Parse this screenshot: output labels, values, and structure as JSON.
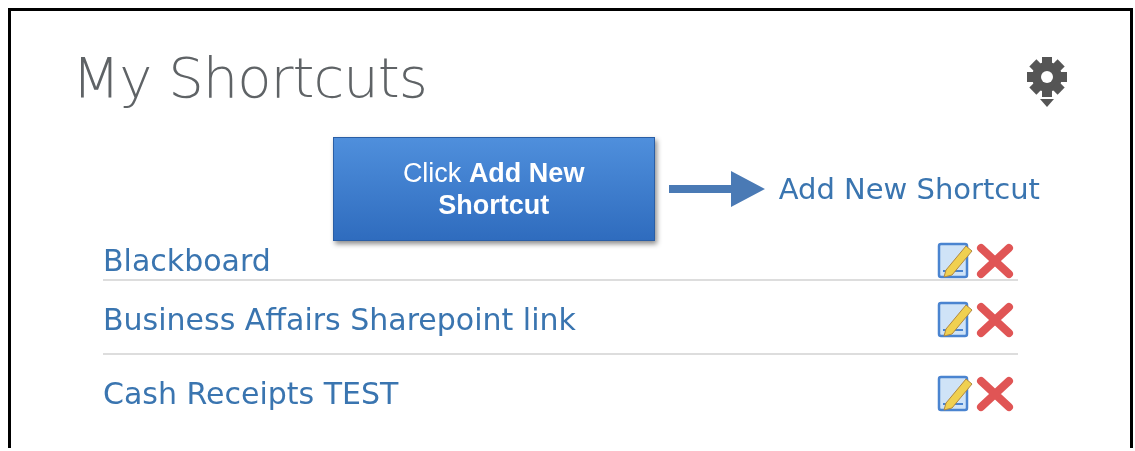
{
  "title": "My Shortcuts",
  "callout": {
    "text": "Click **Add New Shortcut**"
  },
  "add_link": "Add New Shortcut",
  "shortcuts": [
    {
      "label": "Blackboard"
    },
    {
      "label": "Business Affairs Sharepoint link"
    },
    {
      "label": "Cash Receipts TEST"
    }
  ]
}
